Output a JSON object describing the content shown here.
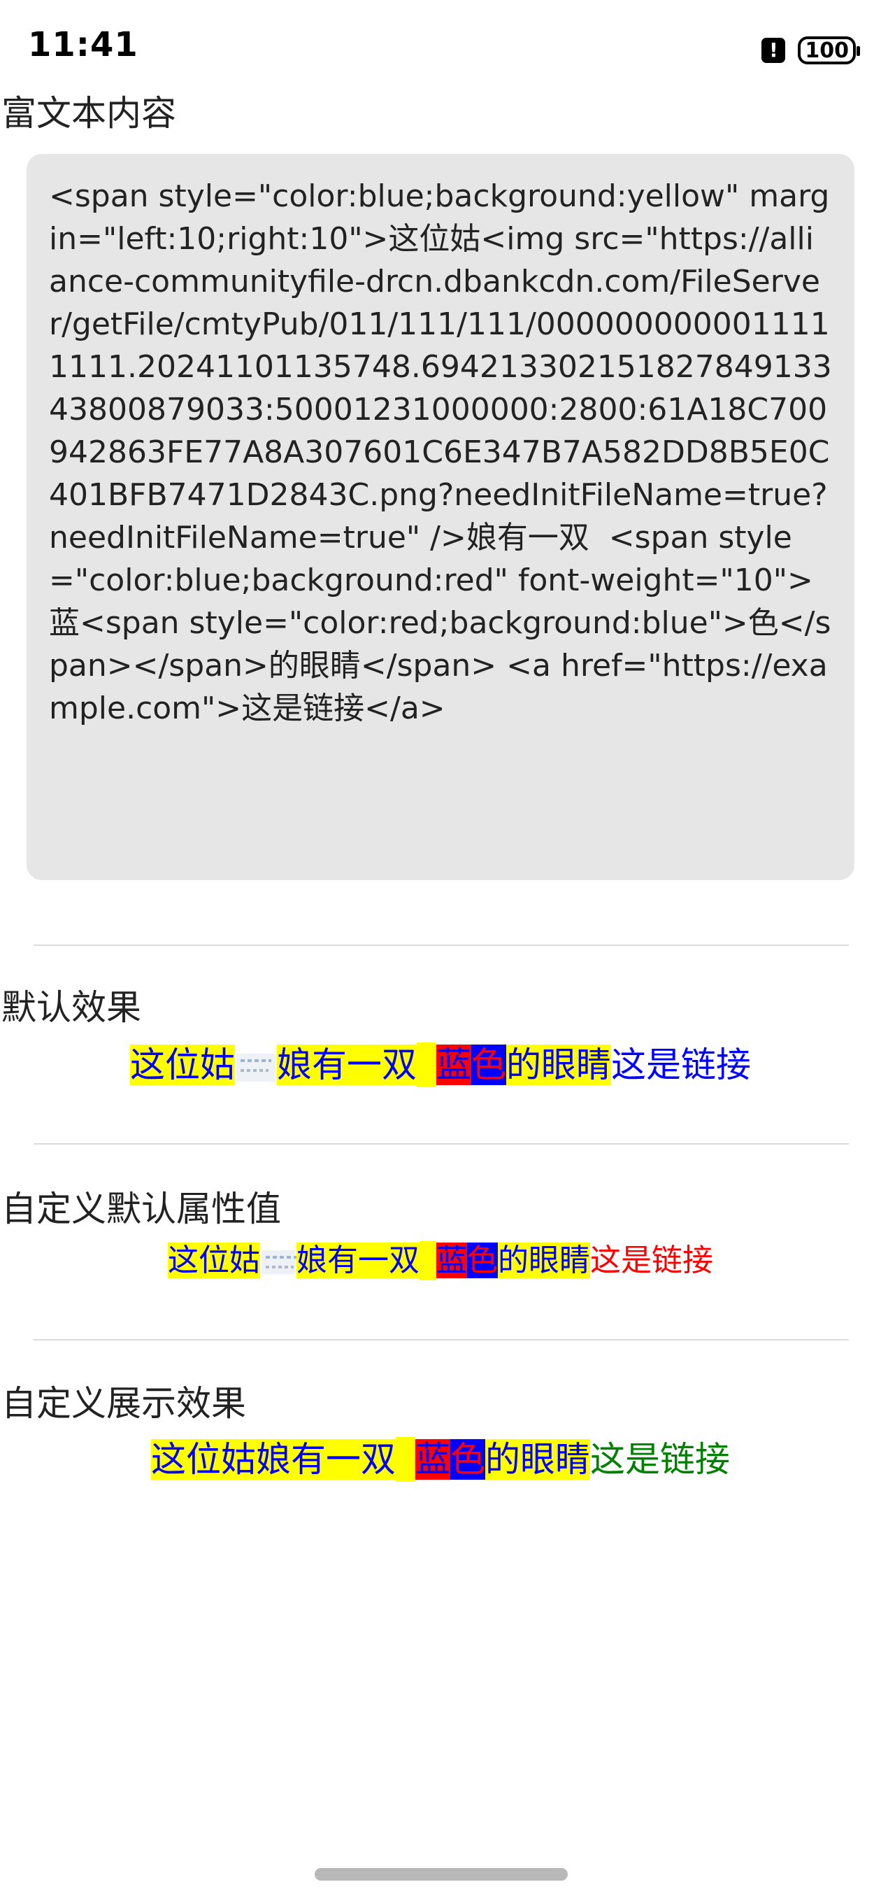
{
  "status_bar": {
    "time": "11:41",
    "alert_icon": "!",
    "battery": "100"
  },
  "sections": {
    "rich_text_title": "富文本内容",
    "default_title": "默认效果",
    "custom_attr_title": "自定义默认属性值",
    "custom_display_title": "自定义展示效果"
  },
  "code": "<span style=\"color:blue;background:yellow\" margin=\"left:10;right:10\">这位姑<img src=\"https://alliance-communityfile-drcn.dbankcdn.com/FileServer/getFile/cmtyPub/011/111/111/0000000000011111111.20241101135748.69421330215182784913343800879033:50001231000000:2800:61A18C700942863FE77A8A307601C6E347B7A582DD8B5E0C401BFB7471D2843C.png?needInitFileName=true?needInitFileName=true\" />娘有一双  <span style=\"color:blue;background:red\" font-weight=\"10\">蓝<span style=\"color:red;background:blue\">色</span></span>的眼睛</span> <a href=\"https://example.com\">这是链接</a>",
  "render": {
    "text_a": "这位姑",
    "text_b": "娘有一双",
    "text_b_full": "这位姑娘有一双",
    "char_lan": "蓝",
    "char_se": "色",
    "text_c": "的眼睛",
    "link": "这是链接"
  },
  "colors": {
    "highlight_bg": "#ffff00",
    "text_blue": "#0000ff",
    "text_red": "#ff0000",
    "link_green": "#008000"
  }
}
